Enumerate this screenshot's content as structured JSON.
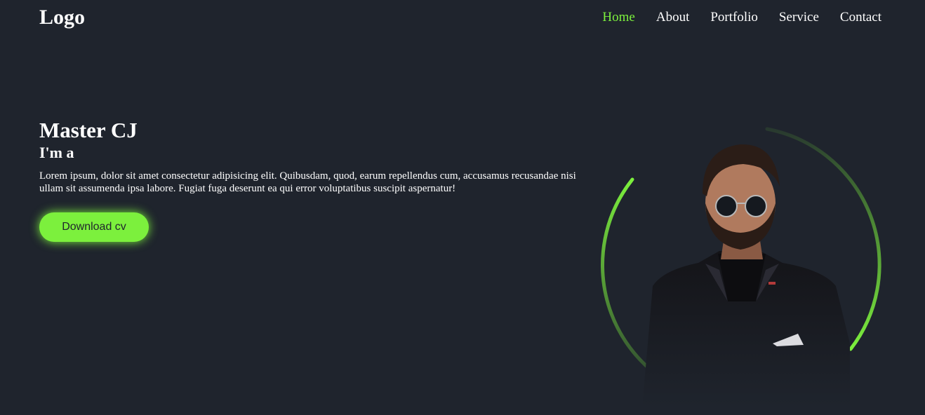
{
  "header": {
    "logo": "Logo",
    "nav": [
      {
        "label": "Home",
        "active": true
      },
      {
        "label": "About",
        "active": false
      },
      {
        "label": "Portfolio",
        "active": false
      },
      {
        "label": "Service",
        "active": false
      },
      {
        "label": "Contact",
        "active": false
      }
    ]
  },
  "hero": {
    "name": "Master CJ",
    "subtitle": "I'm a",
    "description": "Lorem ipsum, dolor sit amet consectetur adipisicing elit. Quibusdam, quod, earum repellendus cum, accusamus recusandae nisi ullam sit assumenda ipsa labore. Fugiat fuga deserunt ea qui error voluptatibus suscipit aspernatur!",
    "button_label": "Download cv"
  },
  "colors": {
    "background": "#1f242d",
    "accent": "#7cf03d",
    "text": "#ffffff"
  },
  "portrait": {
    "icon": "portrait-photo"
  }
}
